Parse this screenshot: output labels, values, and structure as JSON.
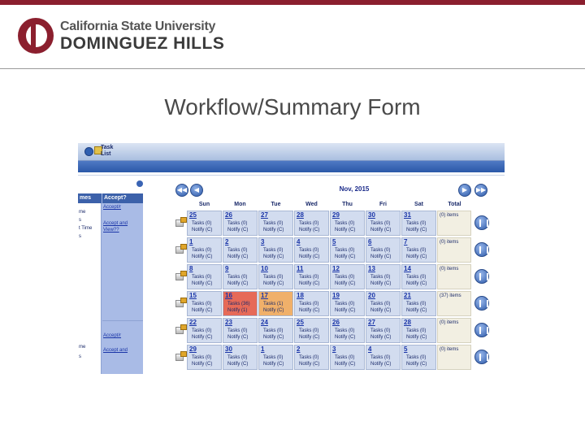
{
  "branding": {
    "line1": "California State University",
    "line2": "DOMINGUEZ HILLS",
    "accent": "#8b1f2e"
  },
  "slide_title": "Workflow/Summary Form",
  "tasklist": {
    "header_label": "Task\nList"
  },
  "left_panel": {
    "col1_header": "mes",
    "col2_header": "Accept?",
    "top_rows": [
      "me",
      "s",
      "t Time",
      "s"
    ],
    "top_accept": [
      "Accept/r",
      "Accept and",
      "View??"
    ],
    "bottom_rows": [
      "me",
      "s"
    ],
    "bottom_accept": [
      "Accept/r",
      "Accept and"
    ]
  },
  "calendar": {
    "month_label": "Nov, 2015",
    "nav": {
      "prev_prev": "◀◀",
      "prev": "◀",
      "next": "▶",
      "next_next": "▶▶"
    },
    "day_headers": [
      "Sun",
      "Mon",
      "Tue",
      "Wed",
      "Thu",
      "Fri",
      "Sat",
      "Total"
    ],
    "weeks": [
      {
        "days": [
          {
            "n": "25",
            "tasks": "Tasks (0)",
            "notify": "Notify (C)"
          },
          {
            "n": "26",
            "tasks": "Tasks (0)",
            "notify": "Notify (C)"
          },
          {
            "n": "27",
            "tasks": "Tasks (0)",
            "notify": "Notify (C)"
          },
          {
            "n": "28",
            "tasks": "Tasks (0)",
            "notify": "Notify (C)"
          },
          {
            "n": "29",
            "tasks": "Tasks (0)",
            "notify": "Notify (C)"
          },
          {
            "n": "30",
            "tasks": "Tasks (0)",
            "notify": "Notify (C)"
          },
          {
            "n": "31",
            "tasks": "Tasks (0)",
            "notify": "Notify (C)"
          }
        ],
        "total": "(0) items"
      },
      {
        "days": [
          {
            "n": "1",
            "tasks": "Tasks (0)",
            "notify": "Notify (C)"
          },
          {
            "n": "2",
            "tasks": "Tasks (0)",
            "notify": "Notify (C)"
          },
          {
            "n": "3",
            "tasks": "Tasks (0)",
            "notify": "Notify (C)"
          },
          {
            "n": "4",
            "tasks": "Tasks (0)",
            "notify": "Notify (C)"
          },
          {
            "n": "5",
            "tasks": "Tasks (0)",
            "notify": "Notify (C)"
          },
          {
            "n": "6",
            "tasks": "Tasks (0)",
            "notify": "Notify (C)"
          },
          {
            "n": "7",
            "tasks": "Tasks (0)",
            "notify": "Notify (C)"
          }
        ],
        "total": "(0) items"
      },
      {
        "days": [
          {
            "n": "8",
            "tasks": "Tasks (0)",
            "notify": "Notify (C)"
          },
          {
            "n": "9",
            "tasks": "Tasks (0)",
            "notify": "Notify (C)"
          },
          {
            "n": "10",
            "tasks": "Tasks (0)",
            "notify": "Notify (C)"
          },
          {
            "n": "11",
            "tasks": "Tasks (0)",
            "notify": "Notify (C)"
          },
          {
            "n": "12",
            "tasks": "Tasks (0)",
            "notify": "Notify (C)"
          },
          {
            "n": "13",
            "tasks": "Tasks (0)",
            "notify": "Notify (C)"
          },
          {
            "n": "14",
            "tasks": "Tasks (0)",
            "notify": "Notify (C)"
          }
        ],
        "total": "(0) items"
      },
      {
        "days": [
          {
            "n": "15",
            "tasks": "Tasks (0)",
            "notify": "Notify (C)"
          },
          {
            "n": "16",
            "tasks": "Tasks (36)",
            "notify": "Notify (1)",
            "highlight": "red"
          },
          {
            "n": "17",
            "tasks": "Tasks (1)",
            "notify": "Notify (C)",
            "highlight": "orange"
          },
          {
            "n": "18",
            "tasks": "Tasks (0)",
            "notify": "Notify (C)"
          },
          {
            "n": "19",
            "tasks": "Tasks (0)",
            "notify": "Notify (C)"
          },
          {
            "n": "20",
            "tasks": "Tasks (0)",
            "notify": "Notify (C)"
          },
          {
            "n": "21",
            "tasks": "Tasks (0)",
            "notify": "Notify (C)"
          }
        ],
        "total": "(37) items"
      },
      {
        "days": [
          {
            "n": "22",
            "tasks": "Tasks (0)",
            "notify": "Notify (C)"
          },
          {
            "n": "23",
            "tasks": "Tasks (0)",
            "notify": "Notify (C)"
          },
          {
            "n": "24",
            "tasks": "Tasks (0)",
            "notify": "Notify (C)"
          },
          {
            "n": "25",
            "tasks": "Tasks (0)",
            "notify": "Notify (C)"
          },
          {
            "n": "26",
            "tasks": "Tasks (0)",
            "notify": "Notify (C)"
          },
          {
            "n": "27",
            "tasks": "Tasks (0)",
            "notify": "Notify (C)"
          },
          {
            "n": "28",
            "tasks": "Tasks (0)",
            "notify": "Notify (C)"
          }
        ],
        "total": "(0) items"
      },
      {
        "days": [
          {
            "n": "29",
            "tasks": "Tasks (0)",
            "notify": "Notify (C)"
          },
          {
            "n": "30",
            "tasks": "Tasks (0)",
            "notify": "Notify (C)"
          },
          {
            "n": "1",
            "tasks": "Tasks (0)",
            "notify": "Notify (C)"
          },
          {
            "n": "2",
            "tasks": "Tasks (0)",
            "notify": "Notify (C)"
          },
          {
            "n": "3",
            "tasks": "Tasks (0)",
            "notify": "Notify (C)"
          },
          {
            "n": "4",
            "tasks": "Tasks (0)",
            "notify": "Notify (C)"
          },
          {
            "n": "5",
            "tasks": "Tasks (0)",
            "notify": "Notify (C)"
          }
        ],
        "total": "(0) items"
      }
    ],
    "row_icon": "edit-icon",
    "summary_icon": "chart-icon"
  }
}
